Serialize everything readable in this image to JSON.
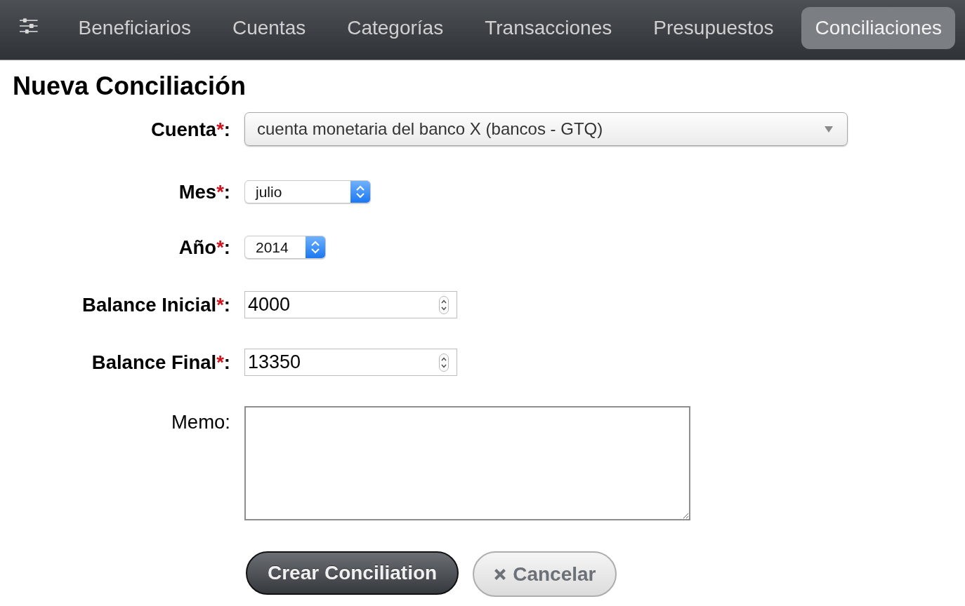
{
  "navbar": {
    "items": [
      {
        "label": "Beneficiarios",
        "selected": false
      },
      {
        "label": "Cuentas",
        "selected": false
      },
      {
        "label": "Categorías",
        "selected": false
      },
      {
        "label": "Transacciones",
        "selected": false
      },
      {
        "label": "Presupuestos",
        "selected": false
      },
      {
        "label": "Conciliaciones",
        "selected": true
      }
    ]
  },
  "form": {
    "title": "Nueva Conciliación",
    "fields": [
      {
        "kind": "select",
        "label": "Cuenta",
        "required_mark": "*",
        "suffix": ":",
        "value": "cuenta monetaria del banco X (bancos - GTQ)"
      },
      {
        "kind": "stepper_select",
        "label": "Mes",
        "required_mark": "*",
        "suffix": ":",
        "value": "julio"
      },
      {
        "kind": "stepper_select",
        "label": "Año",
        "required_mark": "*",
        "suffix": ":",
        "value": "2014"
      },
      {
        "kind": "number",
        "label": "Balance Inicial",
        "required_mark": "*",
        "suffix": ":",
        "value": "4000"
      },
      {
        "kind": "number",
        "label": "Balance Final",
        "required_mark": "*",
        "suffix": ":",
        "value": "13350"
      },
      {
        "kind": "textarea",
        "label": "Memo",
        "suffix": ":"
      }
    ],
    "buttons": [
      {
        "kind": "primary",
        "label": "Crear Conciliation"
      },
      {
        "kind": "cancel",
        "label": "Cancelar"
      }
    ]
  }
}
